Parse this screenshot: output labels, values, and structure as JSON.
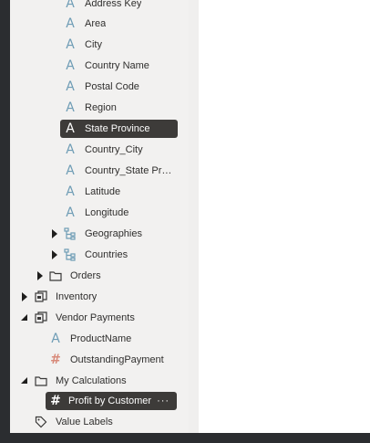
{
  "tree": {
    "items": [
      {
        "label": "Address Key"
      },
      {
        "label": "Area"
      },
      {
        "label": "City"
      },
      {
        "label": "Country Name"
      },
      {
        "label": "Postal Code"
      },
      {
        "label": "Region"
      },
      {
        "label": "State Province"
      },
      {
        "label": "Country_City"
      },
      {
        "label": "Country_State Pr…"
      },
      {
        "label": "Latitude"
      },
      {
        "label": "Longitude"
      },
      {
        "label": "Geographies"
      },
      {
        "label": "Countries"
      },
      {
        "label": "Orders"
      },
      {
        "label": "Inventory"
      },
      {
        "label": "Vendor Payments"
      },
      {
        "label": "ProductName"
      },
      {
        "label": "OutstandingPayment"
      },
      {
        "label": "My Calculations"
      },
      {
        "label": "Profit by Customer"
      },
      {
        "label": "Value Labels"
      }
    ],
    "more_label": "···"
  },
  "icons": {
    "attribute": "A",
    "measure": "#"
  },
  "colors": {
    "selected_bg": "#3d3b39",
    "attribute_icon": "#6e9cb5",
    "measure_icon": "#d88a7a"
  }
}
